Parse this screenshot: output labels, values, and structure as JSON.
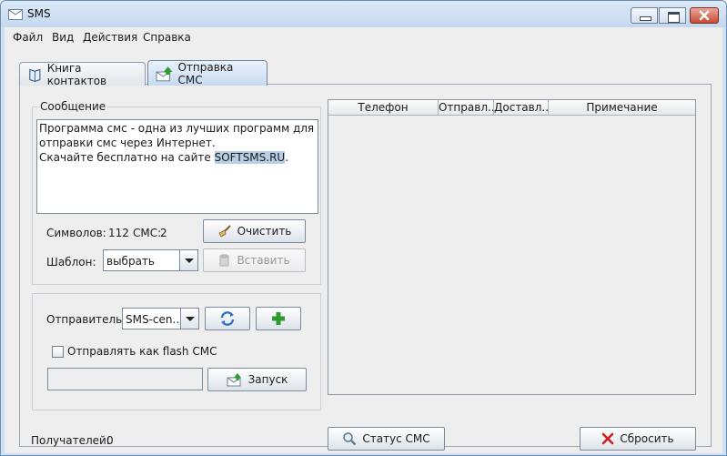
{
  "window": {
    "title": "SMS"
  },
  "menu": [
    "Файл",
    "Вид",
    "Действия",
    "Справка"
  ],
  "tabs": [
    {
      "label": "Книга контактов",
      "icon": "book-icon"
    },
    {
      "label": "Отправка СМС",
      "icon": "envelope-arrow-icon"
    }
  ],
  "message": {
    "group_title": "Сообщение",
    "line1": "Программа смс - одна из лучших программ для",
    "line2": "отправки смс через Интернет.",
    "line3_prefix": "Скачайте бесплатно на сайте ",
    "line3_link": "SOFTSMS.RU",
    "line3_suffix": "."
  },
  "counter": {
    "label": "Символов:",
    "chars": "112",
    "sms_label": "СМС:",
    "sms": "2"
  },
  "clear_button": "Очистить",
  "template": {
    "label": "Шаблон:",
    "value": "выбрать"
  },
  "insert_button": "Вставить",
  "sender": {
    "label": "Отправитель:",
    "value": "SMS-cen..."
  },
  "flash": {
    "label": "Отправлять как flash СМС",
    "checked": false
  },
  "run_button": "Запуск",
  "recipients": {
    "label": "Получателей:",
    "count": "0"
  },
  "table": {
    "columns": [
      "Телефон",
      "Отправл...",
      "Доставл...",
      "Примечание"
    ]
  },
  "status_button": "Статус СМС",
  "reset_button": "Сбросить",
  "colors": {
    "accent": "#6f88a8",
    "selection": "#b8cfe5",
    "close": "#c74d35"
  }
}
